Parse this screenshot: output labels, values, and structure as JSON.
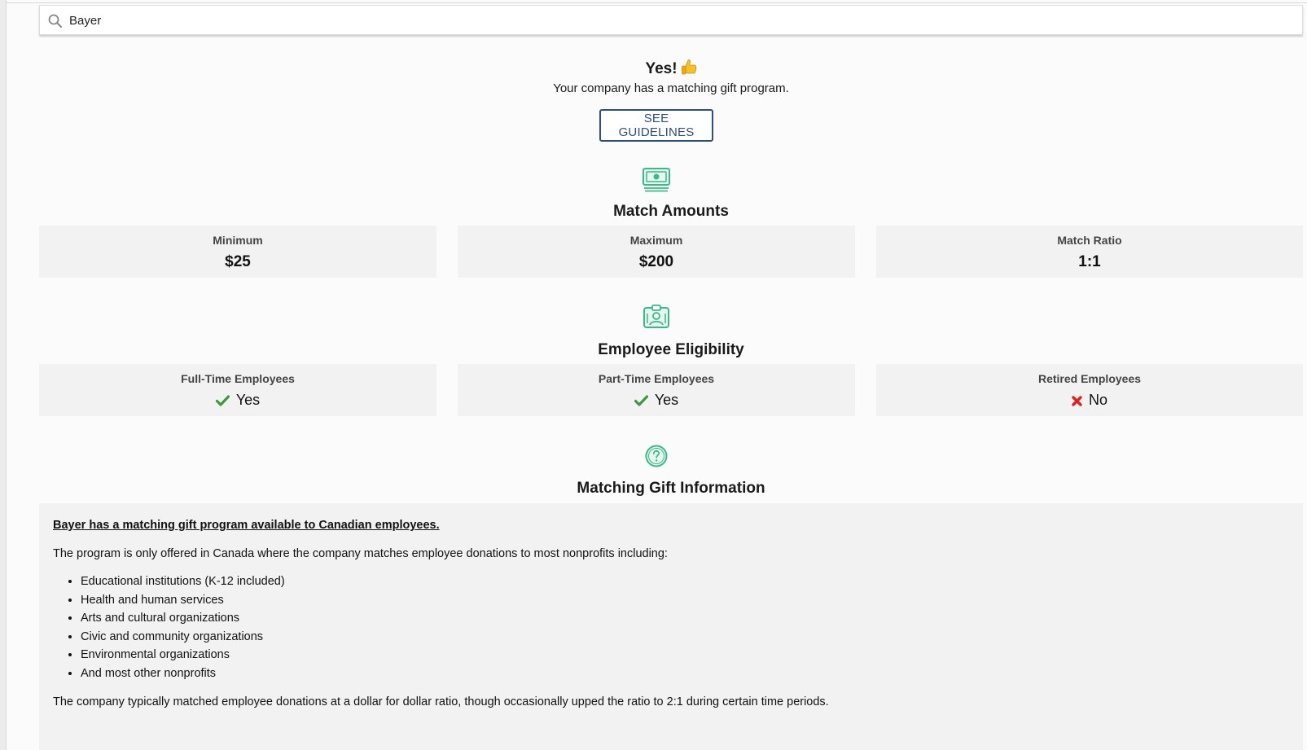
{
  "search": {
    "value": "Bayer",
    "icon": "search-icon"
  },
  "result": {
    "headline": "Yes!",
    "headline_icon": "thumbs-up-icon",
    "subline": "Your company has a matching gift program.",
    "button_label": "SEE GUIDELINES"
  },
  "match_amounts": {
    "icon": "money-icon",
    "title": "Match Amounts",
    "cards": [
      {
        "label": "Minimum",
        "value": "$25"
      },
      {
        "label": "Maximum",
        "value": "$200"
      },
      {
        "label": "Match Ratio",
        "value": "1:1"
      }
    ]
  },
  "eligibility": {
    "icon": "employee-badge-icon",
    "title": "Employee Eligibility",
    "cards": [
      {
        "label": "Full-Time Employees",
        "value": "Yes",
        "status": "yes"
      },
      {
        "label": "Part-Time Employees",
        "value": "Yes",
        "status": "yes"
      },
      {
        "label": "Retired Employees",
        "value": "No",
        "status": "no"
      }
    ]
  },
  "info": {
    "icon": "question-circle-icon",
    "title": "Matching Gift Information",
    "heading": "Bayer has a matching gift program available to Canadian employees.",
    "intro": "The program is only offered in Canada where the company matches employee donations to most nonprofits including:",
    "items": [
      "Educational institutions (K-12 included)",
      "Health and human services",
      "Arts and cultural organizations",
      "Civic and community organizations",
      "Environmental organizations",
      "And most other nonprofits"
    ],
    "ratio_note": "The company typically matched employee donations at a dollar for dollar ratio, though occasionally upped the ratio to 2:1 during certain time periods."
  },
  "colors": {
    "accent_green": "#3bb98a",
    "button_blue": "#2d4f7c",
    "check_green": "#3c9a3c",
    "cross_red": "#e0201b"
  }
}
